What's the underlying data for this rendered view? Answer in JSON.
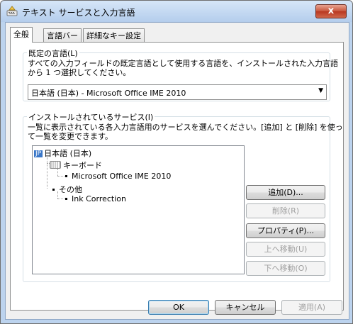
{
  "window": {
    "title": "テキスト サービスと入力言語",
    "close_label": "x"
  },
  "tabs": [
    {
      "label": "全般"
    },
    {
      "label": "言語バー"
    },
    {
      "label": "詳細なキー設定"
    }
  ],
  "default_language": {
    "group_label": "既定の言語(L)",
    "description_line1": "すべての入力フィールドの既定言語として使用する言語を、インストールされた入力言語",
    "description_line2": "から 1 つ選択してください。",
    "selected_value": "日本語 (日本) - Microsoft Office IME 2010",
    "dropdown_icon": "dropdown-arrow-icon"
  },
  "installed_services": {
    "group_label": "インストールされているサービス(I)",
    "description_line1": "一覧に表示されている各入力言語用のサービスを選んでください。[追加] と [削除] を使っ",
    "description_line2": "て一覧を変更できます。",
    "tree": {
      "language_badge": "JP",
      "language": "日本語 (日本)",
      "keyboard_label": "キーボード",
      "keyboard_item": "Microsoft Office IME 2010",
      "other_label": "その他",
      "other_item": "Ink Correction"
    },
    "buttons": {
      "add": "追加(D)...",
      "remove": "削除(R)",
      "properties": "プロパティ(P)...",
      "move_up": "上へ移動(U)",
      "move_down": "下へ移動(O)"
    }
  },
  "footer": {
    "ok": "OK",
    "cancel": "キャンセル",
    "apply": "適用(A)"
  }
}
